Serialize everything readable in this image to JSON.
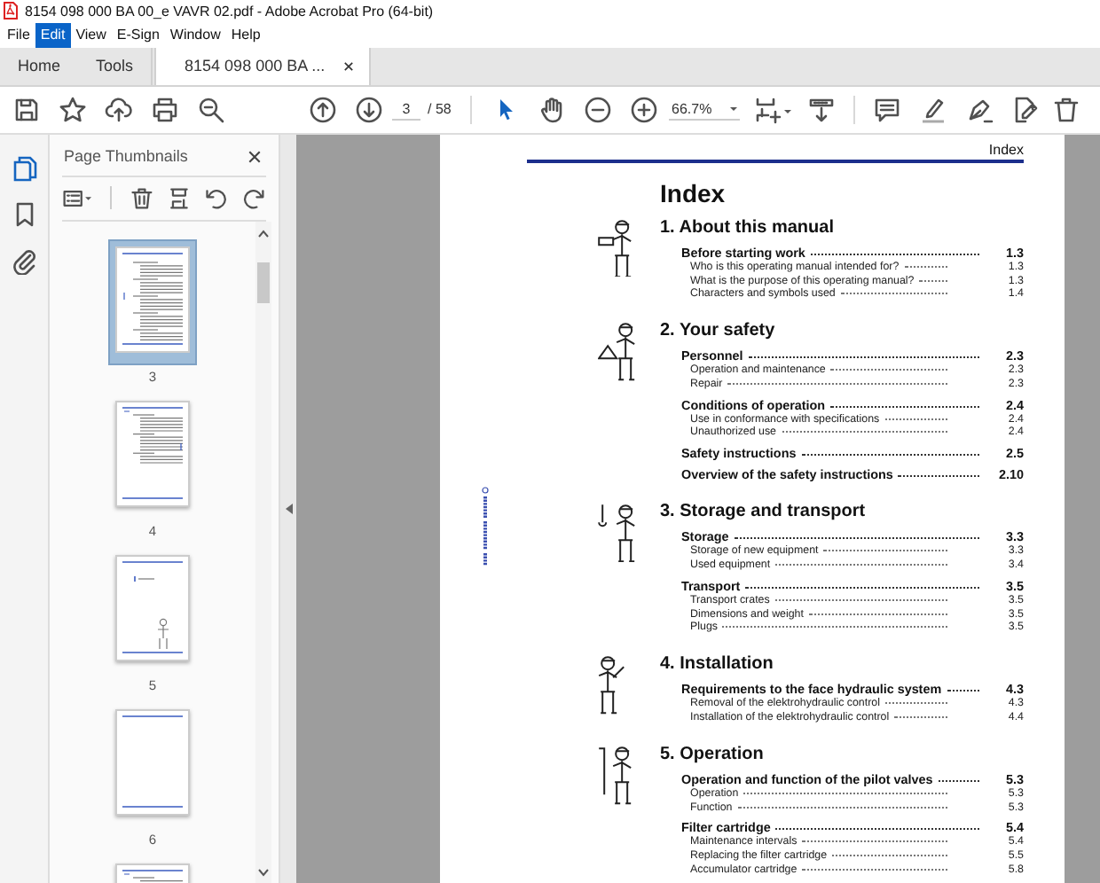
{
  "window": {
    "title": "8154 098 000 BA 00_e VAVR 02.pdf - Adobe Acrobat Pro (64-bit)"
  },
  "menu": [
    {
      "label": "File",
      "selected": false
    },
    {
      "label": "Edit",
      "selected": true
    },
    {
      "label": "View",
      "selected": false
    },
    {
      "label": "E-Sign",
      "selected": false
    },
    {
      "label": "Window",
      "selected": false
    },
    {
      "label": "Help",
      "selected": false
    }
  ],
  "tabs": [
    {
      "label": "Home",
      "selected": false,
      "kind": "nav"
    },
    {
      "label": "Tools",
      "selected": false,
      "kind": "nav"
    },
    {
      "label": "8154 098 000 BA ...",
      "selected": true,
      "kind": "document"
    }
  ],
  "toolbar": {
    "page_current": "3",
    "page_total": "/ 58",
    "zoom": "66.7%"
  },
  "thumbnails_panel": {
    "title": "Page Thumbnails",
    "pages": [
      {
        "label": "3",
        "selected": true,
        "kind": "index"
      },
      {
        "label": "4",
        "selected": false,
        "kind": "list"
      },
      {
        "label": "5",
        "selected": false,
        "kind": "figure"
      },
      {
        "label": "6",
        "selected": false,
        "kind": "blank"
      },
      {
        "selected": false,
        "kind": "list"
      }
    ]
  },
  "document": {
    "running_head": "Index",
    "heading": "Index",
    "sections": [
      {
        "title": "1. About this manual",
        "entries": [
          {
            "kind": "main",
            "text": "Before starting work",
            "page": "1.3"
          },
          {
            "kind": "sub",
            "text": "Who is this operating manual intended for?",
            "page": "1.3"
          },
          {
            "kind": "sub",
            "text": "What is the purpose of this operating manual?",
            "page": "1.3"
          },
          {
            "kind": "sub",
            "text": "Characters and symbols used",
            "page": "1.4"
          }
        ]
      },
      {
        "title": "2. Your safety",
        "entries": [
          {
            "kind": "main",
            "text": "Personnel",
            "page": "2.3"
          },
          {
            "kind": "sub",
            "text": "Operation and maintenance",
            "page": "2.3"
          },
          {
            "kind": "sub",
            "text": "Repair",
            "page": "2.3"
          },
          {
            "kind": "main",
            "text": "Conditions of operation",
            "page": "2.4"
          },
          {
            "kind": "sub",
            "text": "Use in conformance with specifications",
            "page": "2.4"
          },
          {
            "kind": "sub",
            "text": "Unauthorized use",
            "page": "2.4"
          },
          {
            "kind": "main",
            "text": "Safety instructions",
            "page": "2.5"
          },
          {
            "kind": "main",
            "text": "Overview of the safety instructions",
            "page": "2.10"
          }
        ]
      },
      {
        "title": "3. Storage and transport",
        "entries": [
          {
            "kind": "main",
            "text": "Storage",
            "page": "3.3"
          },
          {
            "kind": "sub",
            "text": "Storage of new equipment",
            "page": "3.3"
          },
          {
            "kind": "sub",
            "text": "Used equipment",
            "page": "3.4"
          },
          {
            "kind": "main",
            "text": "Transport",
            "page": "3.5"
          },
          {
            "kind": "sub",
            "text": "Transport crates",
            "page": "3.5"
          },
          {
            "kind": "sub",
            "text": "Dimensions and weight",
            "page": "3.5"
          },
          {
            "kind": "sub",
            "text": "Plugs",
            "page": "3.5"
          }
        ]
      },
      {
        "title": "4. Installation",
        "entries": [
          {
            "kind": "main",
            "text": "Requirements to the face hydraulic system",
            "page": "4.3"
          },
          {
            "kind": "sub",
            "text": "Removal of the elektrohydraulic control",
            "page": "4.3"
          },
          {
            "kind": "sub",
            "text": "Installation of the elektrohydraulic control",
            "page": "4.4"
          }
        ]
      },
      {
        "title": "5. Operation",
        "entries": [
          {
            "kind": "main",
            "text": "Operation and function of the pilot valves",
            "page": "5.3"
          },
          {
            "kind": "sub",
            "text": "Operation",
            "page": "5.3"
          },
          {
            "kind": "sub",
            "text": "Function",
            "page": "5.3"
          },
          {
            "kind": "main",
            "text": "Filter cartridge",
            "page": "5.4"
          },
          {
            "kind": "sub",
            "text": "Maintenance intervals",
            "page": "5.4"
          },
          {
            "kind": "sub",
            "text": "Replacing the filter cartridge",
            "page": "5.5"
          },
          {
            "kind": "sub",
            "text": "Accumulator cartridge",
            "page": "5.8"
          }
        ]
      }
    ]
  }
}
